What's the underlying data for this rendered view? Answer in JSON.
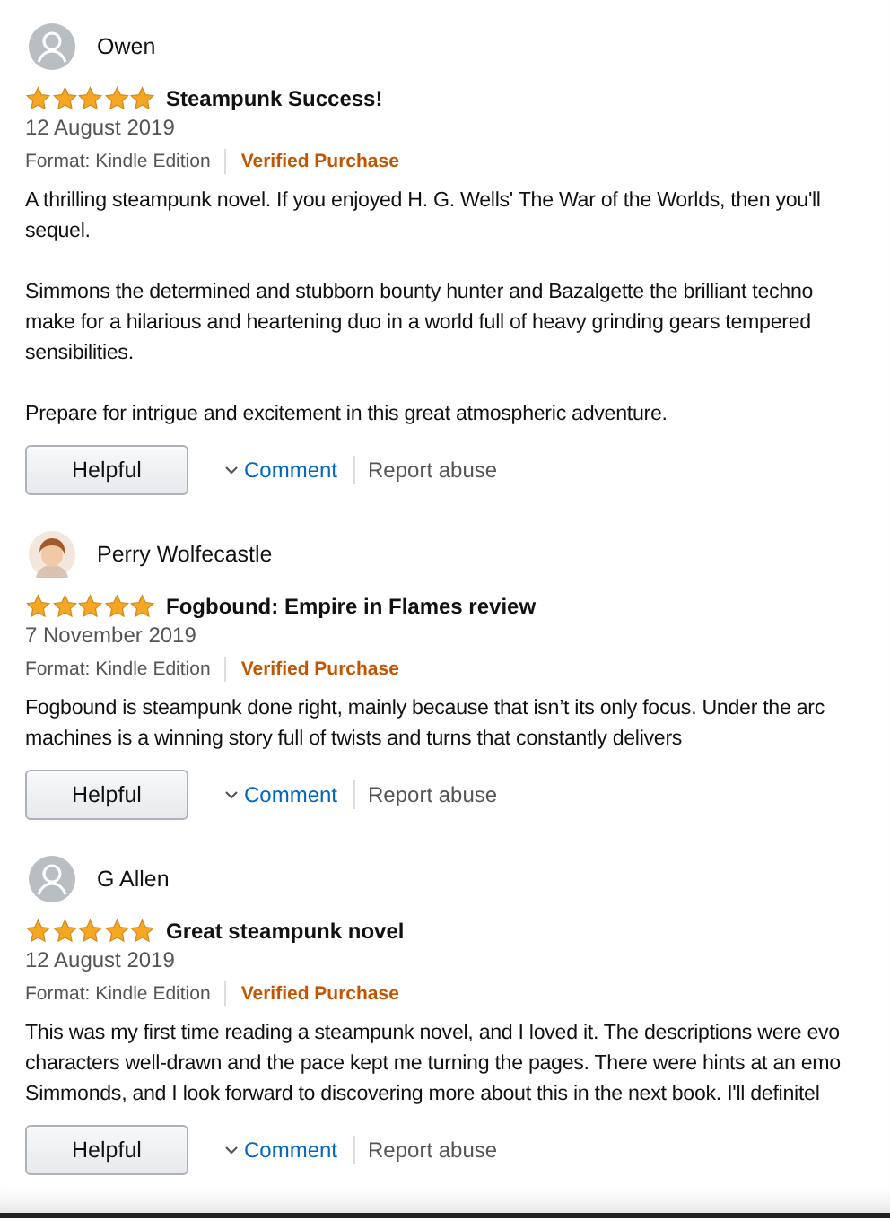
{
  "reviews": [
    {
      "author": "Owen",
      "avatar": {
        "kind": "default"
      },
      "stars": 5,
      "title": "Steampunk Success!",
      "date": "12 August 2019",
      "format": "Format: Kindle Edition",
      "badge": "Verified Purchase",
      "paragraphs": [
        [
          "A thrilling steampunk novel. If you enjoyed H. G. Wells' The War of the Worlds, then you'll",
          "sequel."
        ],
        [
          "Simmons the determined and stubborn bounty hunter and Bazalgette the brilliant techno",
          "make for a hilarious and heartening duo in a world full of heavy grinding gears tempered",
          "sensibilities."
        ],
        [
          "Prepare for intrigue and excitement in this great atmospheric adventure."
        ]
      ],
      "helpful": "Helpful",
      "comment": "Comment",
      "report": "Report abuse"
    },
    {
      "author": "Perry Wolfecastle",
      "avatar": {
        "kind": "picture"
      },
      "stars": 5,
      "title": "Fogbound: Empire in Flames review",
      "date": "7 November 2019",
      "format": "Format: Kindle Edition",
      "badge": "Verified Purchase",
      "paragraphs": [
        [
          "Fogbound is steampunk done right, mainly because that isn’t its only focus. Under the arc",
          "machines is a winning story full of twists and turns that constantly delivers"
        ]
      ],
      "helpful": "Helpful",
      "comment": "Comment",
      "report": "Report abuse"
    },
    {
      "author": "G Allen",
      "avatar": {
        "kind": "default"
      },
      "stars": 5,
      "title": "Great steampunk novel",
      "date": "12 August 2019",
      "format": "Format: Kindle Edition",
      "badge": "Verified Purchase",
      "paragraphs": [
        [
          "This was my first time reading a steampunk novel, and I loved it. The descriptions were evo",
          "characters well-drawn and the pace kept me turning the pages. There were hints at an emo",
          "Simmonds, and I look forward to discovering more about this in the next book. I'll definitel"
        ]
      ],
      "helpful": "Helpful",
      "comment": "Comment",
      "report": "Report abuse"
    }
  ]
}
